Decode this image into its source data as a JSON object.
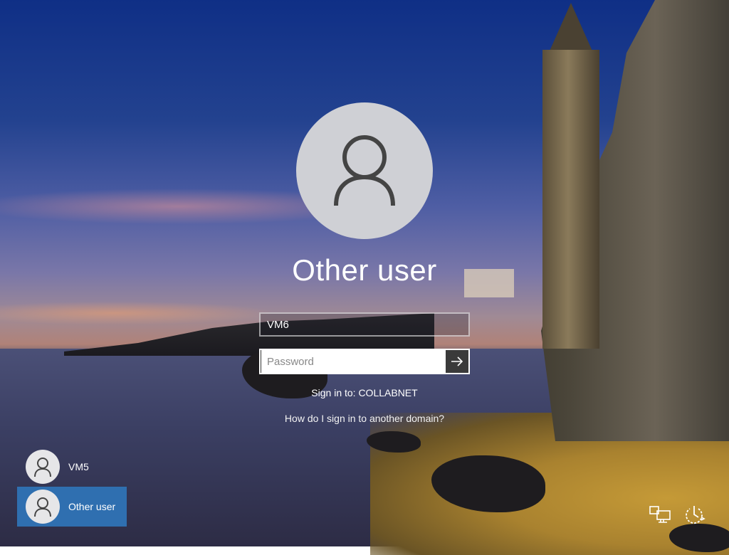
{
  "login": {
    "title": "Other user",
    "username_value": "VM6",
    "password_placeholder": "Password",
    "sign_in_to": "Sign in to: COLLABNET",
    "domain_help": "How do I sign in to another domain?"
  },
  "users": [
    {
      "name": "VM5",
      "active": false
    },
    {
      "name": "Other user",
      "active": true
    }
  ],
  "tray": {
    "network_icon": "network-icon",
    "power_icon": "power-icon"
  },
  "colors": {
    "selected_user": "#2f6fb0",
    "submit_button": "#3a3a3a",
    "avatar": "#cfd0d5"
  }
}
